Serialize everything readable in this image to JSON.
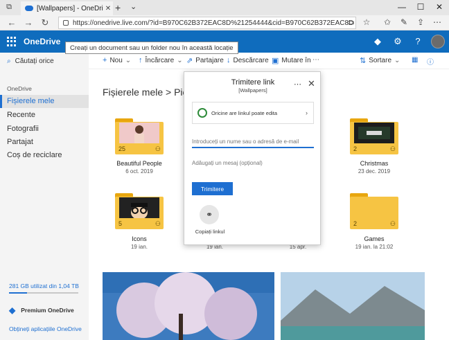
{
  "browser": {
    "tab_title": "[Wallpapers] - OneDrive",
    "url": "https://onedrive.live.com/?id=B970C62B372EAC8D%21254444&cid=B970C62B372EAC8D"
  },
  "header": {
    "brand": "OneDrive",
    "tooltip": "Creați un document sau un folder nou în această locație"
  },
  "commandbar": {
    "search_placeholder": "Căutați orice",
    "new": "Nou",
    "upload": "Încărcare",
    "share": "Partajare",
    "download": "Descărcare",
    "move": "Mutare în",
    "sort": "Sortare"
  },
  "leftnav": {
    "heading": "OneDrive",
    "items": [
      {
        "label": "Fișierele mele"
      },
      {
        "label": "Recente"
      },
      {
        "label": "Fotografii"
      },
      {
        "label": "Partajat"
      },
      {
        "label": "Coș de reciclare"
      }
    ],
    "storage": "281 GB utilizat din 1,04 TB",
    "storage_used_fraction": 0.26,
    "premium": "Premium OneDrive",
    "get_apps": "Obțineți aplicațiile OneDrive"
  },
  "main": {
    "breadcrumb": "Fișierele mele  >  Pictu",
    "folders": [
      {
        "name": "Beautiful People",
        "date": "6 oct. 2019",
        "count": "25"
      },
      {
        "name": "Christmas",
        "date": "23 dec. 2019",
        "count": "2"
      },
      {
        "name": "Icons",
        "date": "19 ian.",
        "count": "5"
      },
      {
        "name": "",
        "date": "19 ian.",
        "count": ""
      },
      {
        "name": "",
        "date": "15 apr.",
        "count": ""
      },
      {
        "name": "Games",
        "date": "19 ian. la 21:02",
        "count": "2"
      }
    ]
  },
  "dialog": {
    "title": "Trimitere link",
    "subtitle": "[Wallpapers]",
    "permission": "Oricine are linkul poate edita",
    "name_placeholder": "Introduceți un nume sau o adresă de e-mail",
    "message_placeholder": "Adăugați un mesaj (opțional)",
    "send": "Trimitere",
    "copy_link": "Copiați linkul"
  }
}
